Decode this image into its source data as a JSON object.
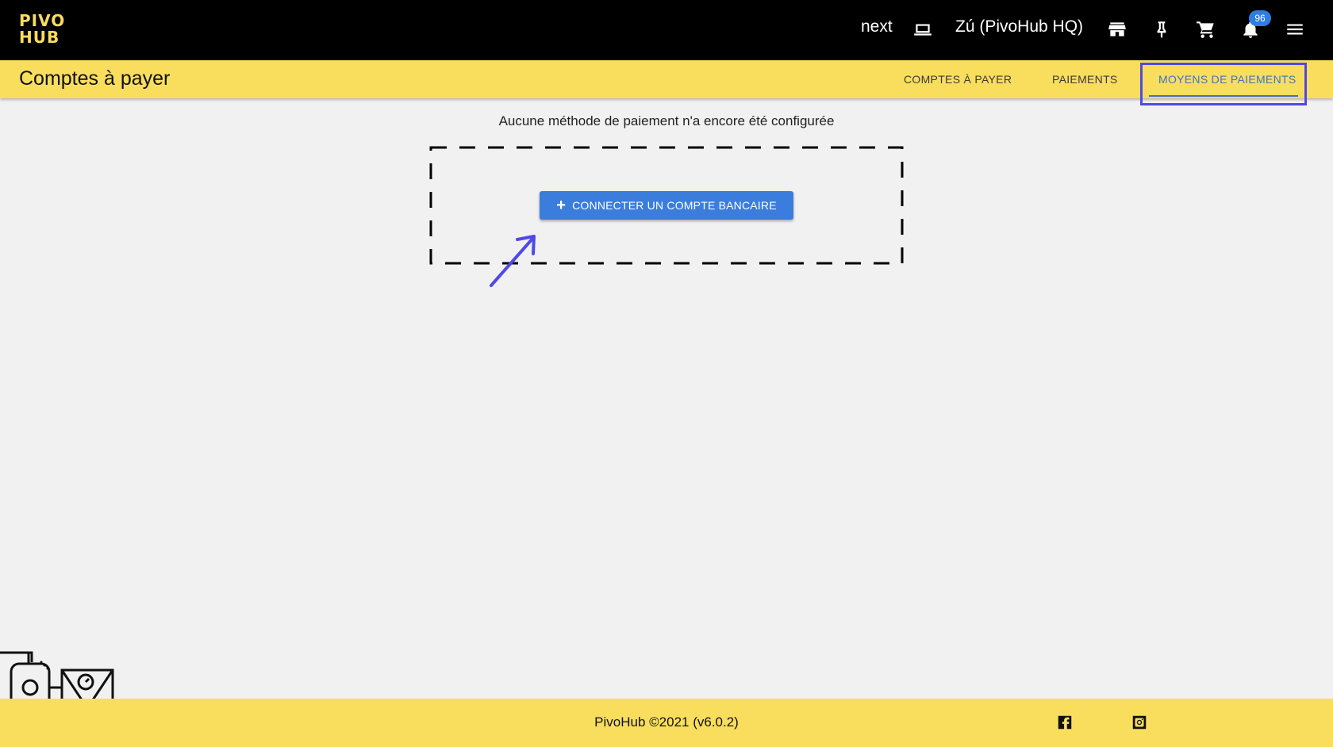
{
  "app": {
    "logo_line1": "PIVO",
    "logo_line2": "HUB",
    "logo_color": "#f9dc5c",
    "env_label": "next",
    "account_label": "Zú (PivoHub HQ)",
    "notification_count": "96",
    "icons": [
      "laptop-icon",
      "store-icon",
      "pin-icon",
      "cart-icon",
      "bell-icon",
      "menu-icon"
    ]
  },
  "header": {
    "title": "Comptes à payer",
    "tabs": [
      {
        "label": "COMPTES À PAYER",
        "active": false
      },
      {
        "label": "PAIEMENTS",
        "active": false
      },
      {
        "label": "MOYENS DE PAIEMENTS",
        "active": true
      }
    ],
    "background": "#f9de5e",
    "accent": "#3b73c8"
  },
  "main": {
    "empty_message": "Aucune méthode de paiement n'a encore été configurée",
    "connect_button_label": "CONNECTER UN COMPTE BANCAIRE",
    "button_color": "#3b7ddd"
  },
  "footer": {
    "text": "PivoHub ©2021 (v6.0.2)",
    "social": [
      "facebook-icon",
      "instagram-icon"
    ]
  }
}
